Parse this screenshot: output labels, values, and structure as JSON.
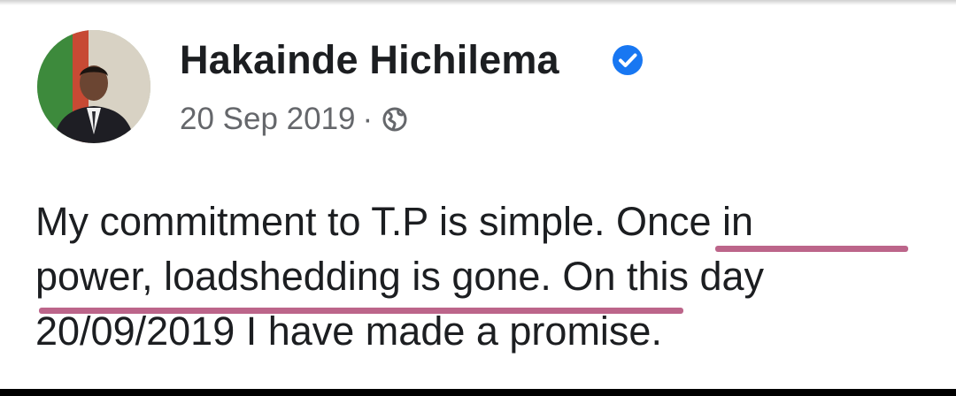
{
  "post": {
    "author": "Hakainde Hichilema",
    "date": "20 Sep 2019",
    "separator": "·",
    "audience_icon": "globe-icon",
    "verified_icon": "verified-badge-icon",
    "body_lines": [
      "My commitment to T.P is simple. Once in",
      "power, loadshedding is gone. On this day",
      "20/09/2019 I have made a promise."
    ]
  },
  "colors": {
    "verified": "#1877f2",
    "underline": "#b5547d",
    "meta_text": "#65676b"
  }
}
